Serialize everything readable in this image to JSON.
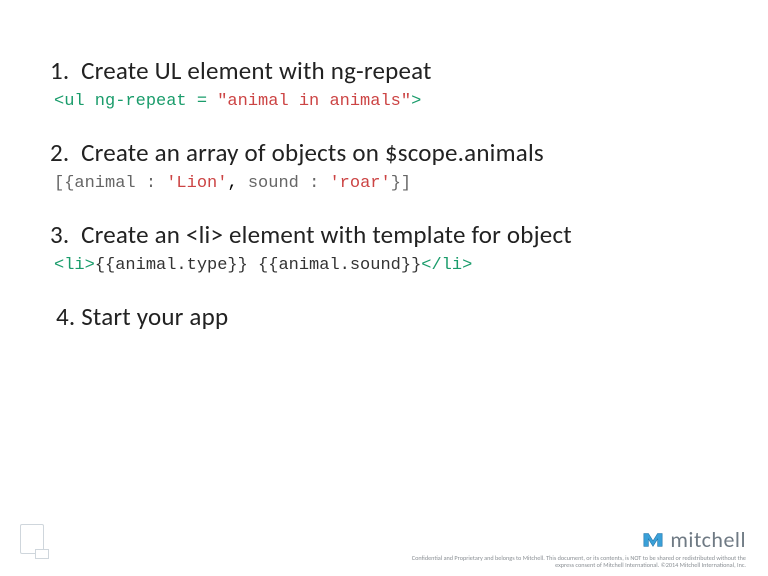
{
  "steps": [
    {
      "num": "1.",
      "text": "Create UL element with ng-repeat"
    },
    {
      "num": "2.",
      "text": "Create an array of objects on $scope.animals"
    },
    {
      "num": "3.",
      "text": "Create an <li> element with template for object"
    },
    {
      "num": "4.",
      "text": "Start your app"
    }
  ],
  "code": {
    "line1": {
      "open": "<ul",
      "attr": " ng-repeat = ",
      "val": "\"animal in animals\"",
      "close": ">"
    },
    "line2": {
      "lbracket": "[{",
      "k1": "animal",
      "sep1": " : ",
      "v1": "'Lion'",
      "comma": ", ",
      "k2": "sound",
      "sep2": " : ",
      "v2": "'roar'",
      "rbracket": "}]"
    },
    "line3": {
      "open": "<li>",
      "body": "{{animal.type}} {{animal.sound}}",
      "close": "</li>"
    }
  },
  "footer": {
    "brand": "mitchell",
    "disclaimer": "Confidential and Proprietary and belongs to Mitchell. This document, or its contents, is NOT to be shared or redistributed without the express consent of Mitchell International. ©2014 Mitchell International, Inc."
  }
}
